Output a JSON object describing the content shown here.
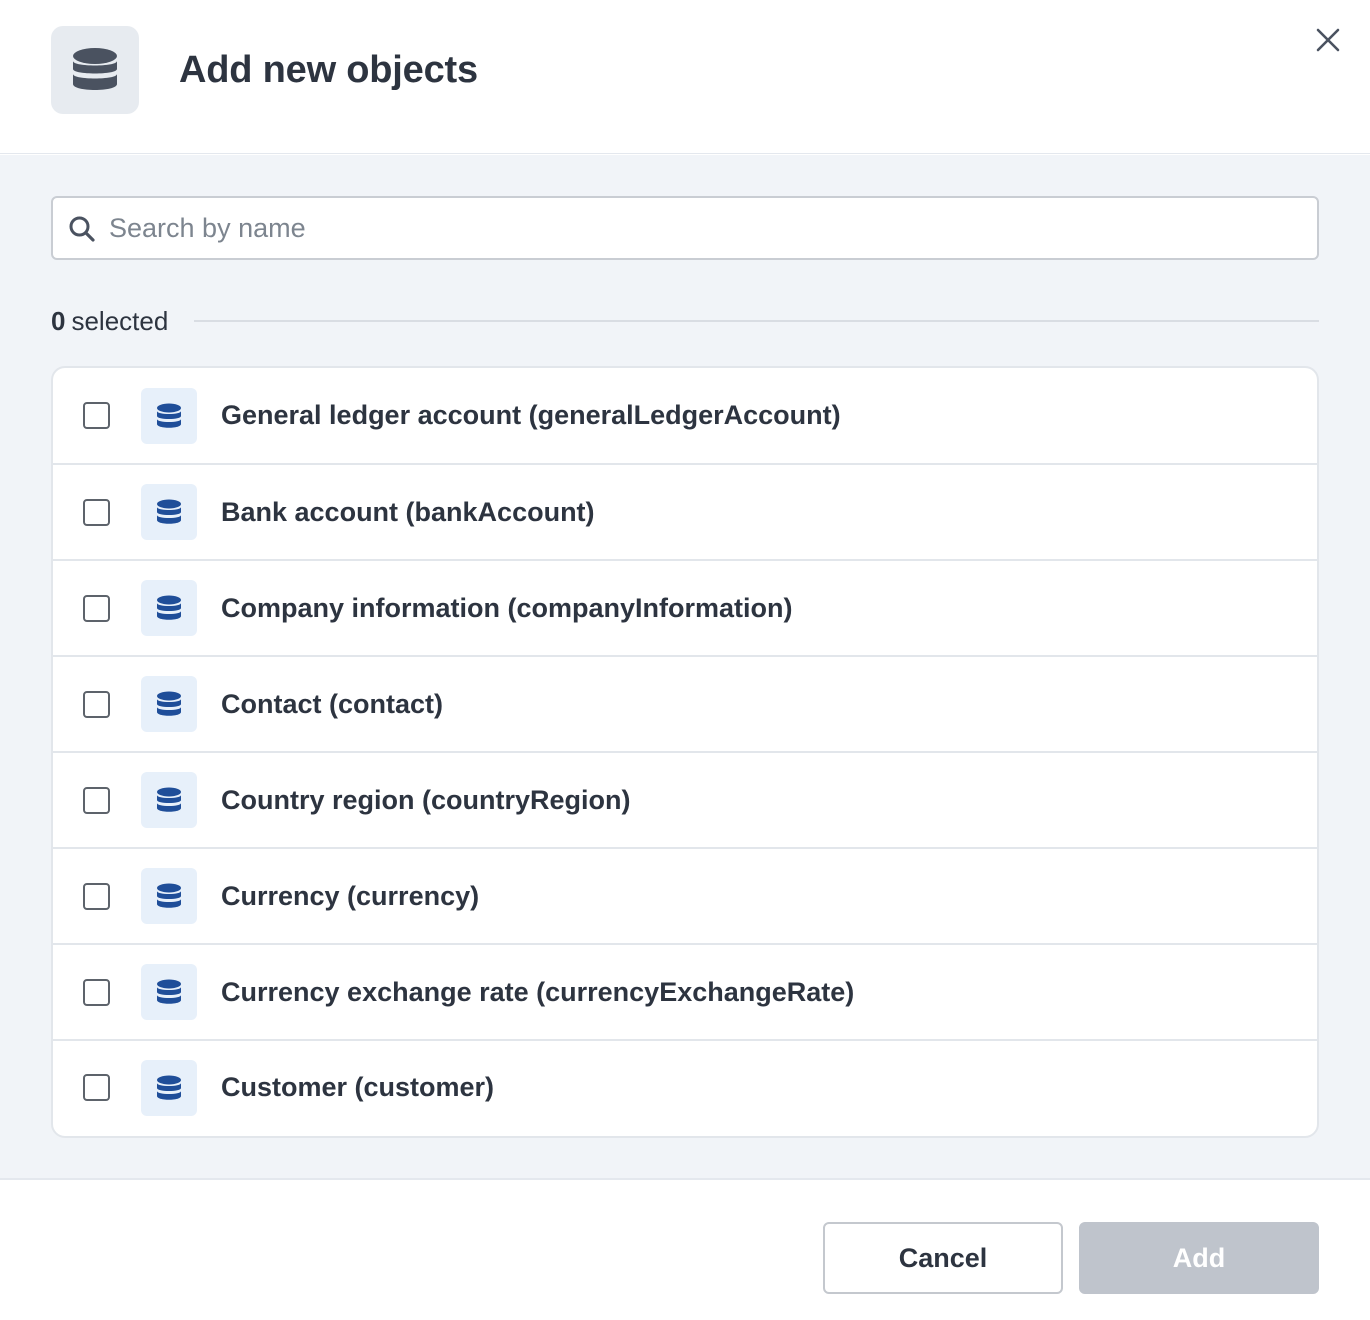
{
  "header": {
    "title": "Add new objects",
    "icon": "database-icon"
  },
  "search": {
    "placeholder": "Search by name",
    "value": ""
  },
  "selection": {
    "count": "0",
    "label": "selected"
  },
  "items": [
    {
      "label": "General ledger account (generalLedgerAccount)",
      "checked": false
    },
    {
      "label": "Bank account (bankAccount)",
      "checked": false
    },
    {
      "label": "Company information (companyInformation)",
      "checked": false
    },
    {
      "label": "Contact (contact)",
      "checked": false
    },
    {
      "label": "Country region (countryRegion)",
      "checked": false
    },
    {
      "label": "Currency (currency)",
      "checked": false
    },
    {
      "label": "Currency exchange rate (currencyExchangeRate)",
      "checked": false
    },
    {
      "label": "Customer (customer)",
      "checked": false
    }
  ],
  "footer": {
    "cancel_label": "Cancel",
    "add_label": "Add"
  },
  "colors": {
    "accent": "#1f4e99",
    "icon_bg": "#e7f0fa",
    "add_disabled": "#bfc4cc"
  }
}
